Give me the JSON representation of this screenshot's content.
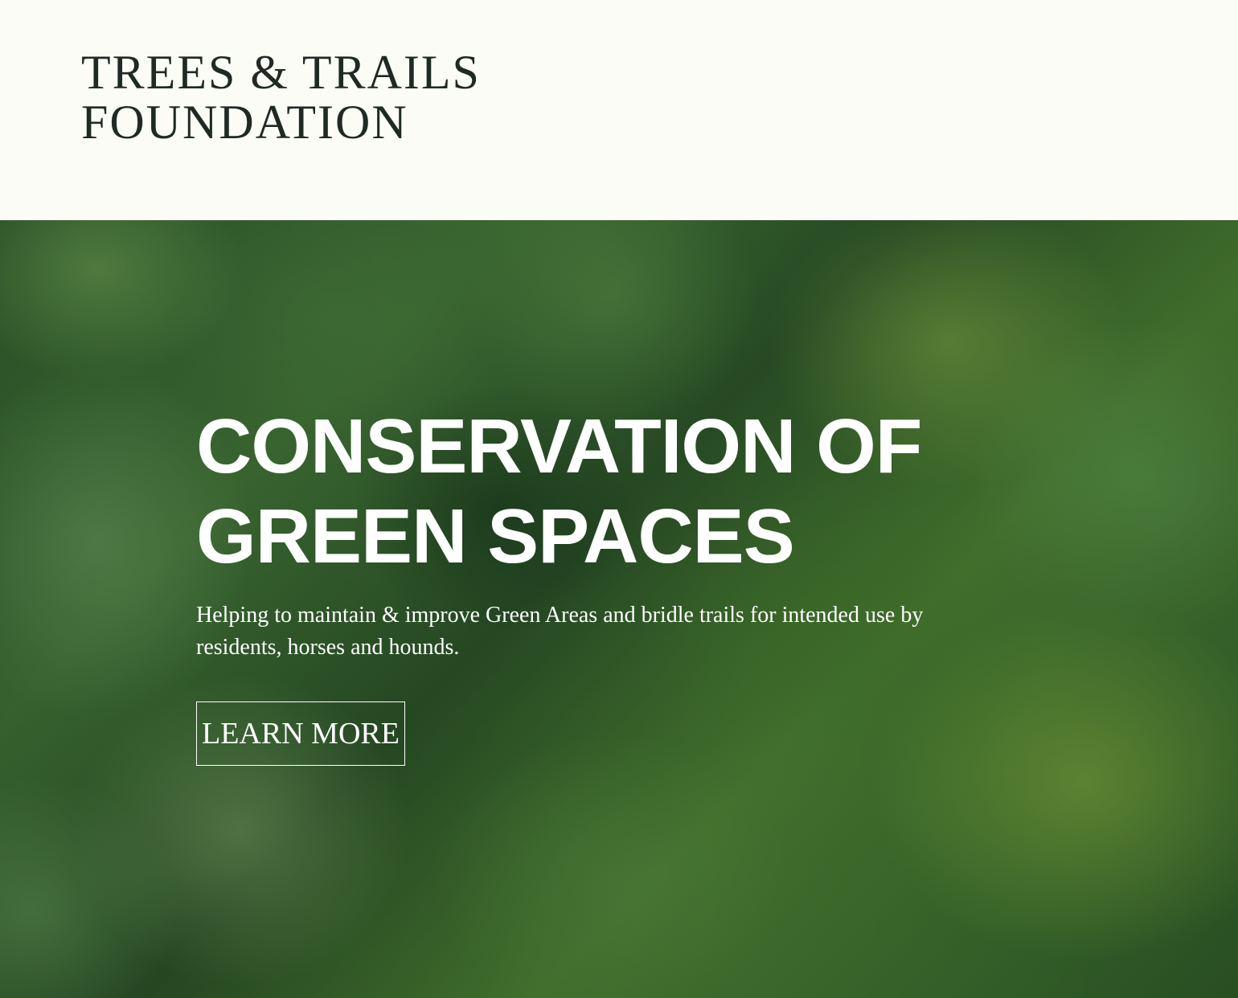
{
  "header": {
    "logo": {
      "line1": "TREES & TRAILS",
      "line2": "FOUNDATION"
    }
  },
  "hero": {
    "title": "CONSERVATION OF GREEN SPACES",
    "subtitle": "Helping to maintain & improve Green Areas and bridle trails for intended use by residents, horses and hounds.",
    "cta_label": "LEARN MORE",
    "background": "aerial view of green forest treetops"
  },
  "colors": {
    "header_bg": "#fcfcf7",
    "logo_text": "#1f2a24",
    "hero_text": "#ffffff",
    "forest_green": "#3e6e34"
  }
}
